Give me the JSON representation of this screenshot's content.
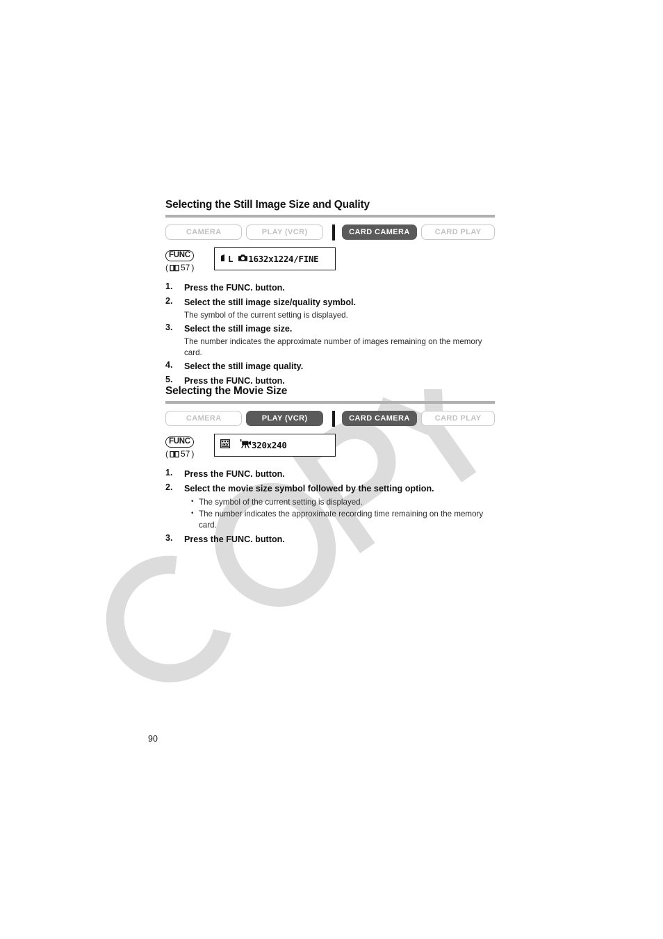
{
  "page": {
    "number": "90",
    "watermark": "COPY"
  },
  "sections": [
    {
      "id": "still-image",
      "heading": "Selecting the Still Image Size and Quality",
      "modes": [
        {
          "label": "CAMERA",
          "active": false
        },
        {
          "label": "PLAY (VCR)",
          "active": false
        },
        {
          "label": "CARD CAMERA",
          "active": true
        },
        {
          "label": "CARD PLAY",
          "active": false
        }
      ],
      "func": {
        "badge": "FUNC",
        "ref_open": "(",
        "ref_icon": "book-icon",
        "ref_page": "57",
        "ref_close": ")"
      },
      "display": {
        "quality_icon": "quality-bar-icon",
        "size_letter": "L",
        "media_icon": "still-camera-icon",
        "value": "1632x1224/FINE"
      },
      "steps": [
        {
          "num": "1.",
          "title": "Press the FUNC. button."
        },
        {
          "num": "2.",
          "title": "Select the still image size/quality symbol.",
          "note": "The symbol of the current setting is displayed."
        },
        {
          "num": "3.",
          "title": "Select the still image size.",
          "note": "The number indicates the approximate number of images remaining on the memory card."
        },
        {
          "num": "4.",
          "title": "Select the still image quality."
        },
        {
          "num": "5.",
          "title": "Press the FUNC. button."
        }
      ]
    },
    {
      "id": "movie-size",
      "heading": "Selecting the Movie Size",
      "modes": [
        {
          "label": "CAMERA",
          "active": false
        },
        {
          "label": "PLAY (VCR)",
          "active": true
        },
        {
          "label": "CARD CAMERA",
          "active": true
        },
        {
          "label": "CARD PLAY",
          "active": false
        }
      ],
      "func": {
        "badge": "FUNC",
        "ref_open": "(",
        "ref_icon": "book-icon",
        "ref_page": "57",
        "ref_close": ")"
      },
      "display": {
        "size_icon_label": "320",
        "media_icon": "movie-camera-icon",
        "value": "320x240"
      },
      "steps": [
        {
          "num": "1.",
          "title": "Press the FUNC. button."
        },
        {
          "num": "2.",
          "title": "Select the movie size symbol followed by the setting option.",
          "bullets": [
            "The symbol of the current setting is displayed.",
            "The number indicates the approximate recording time remaining on the memory card."
          ]
        },
        {
          "num": "3.",
          "title": "Press the FUNC. button."
        }
      ]
    }
  ],
  "colors": {
    "active_button": "#5a5a5a",
    "inactive_text": "#c2c2c2",
    "rule": "#b0b0b0",
    "watermark": "#dcdcdc"
  }
}
